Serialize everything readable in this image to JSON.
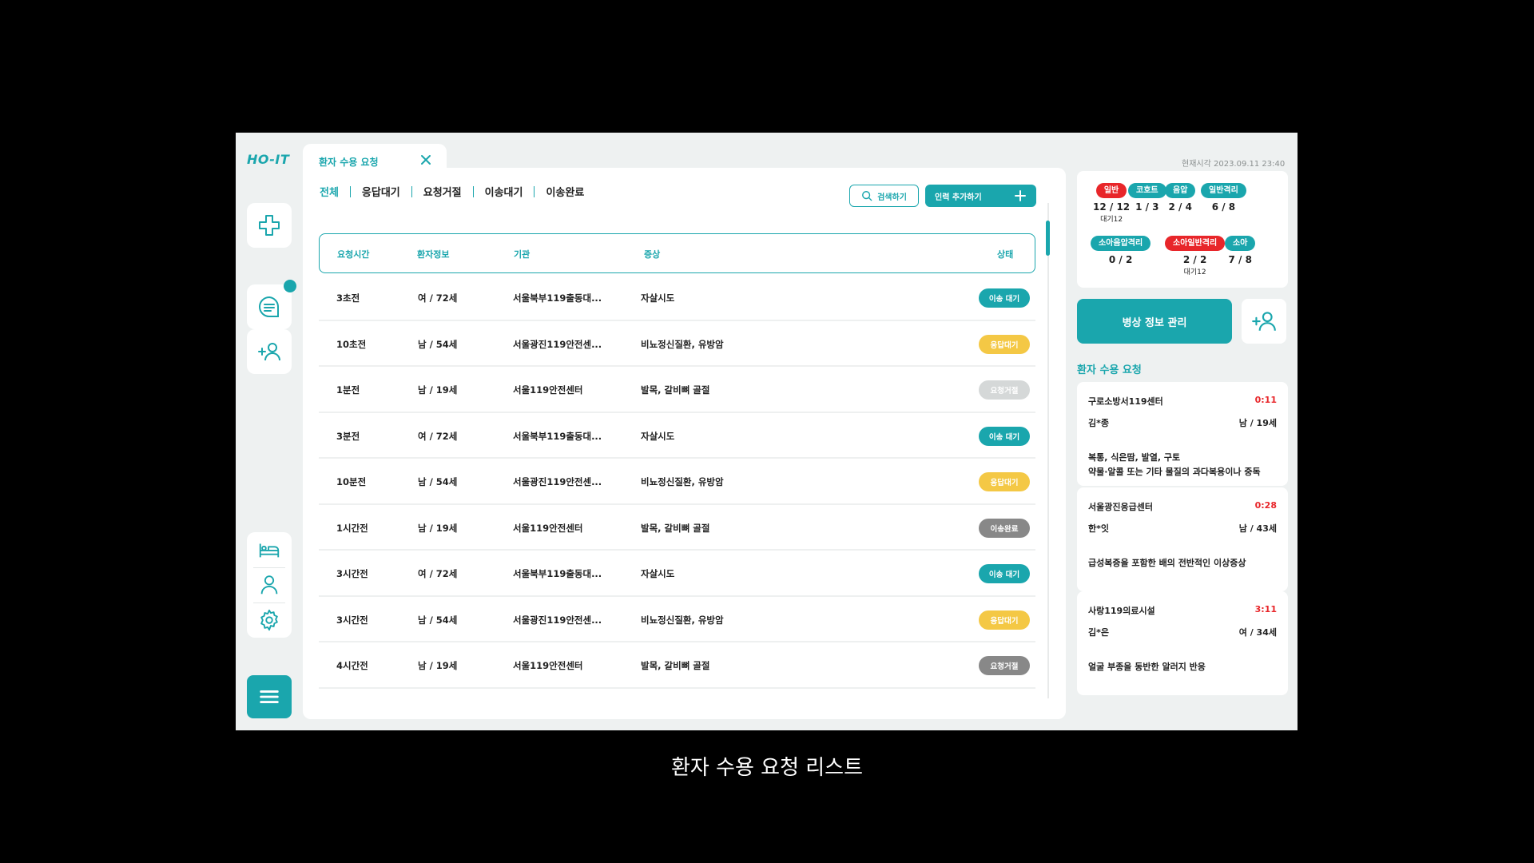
{
  "app": {
    "logo": "HO-IT"
  },
  "tab": {
    "label": "환자 수용 요청"
  },
  "filters": [
    "전체",
    "응답대기",
    "요청거절",
    "이송대기",
    "이송완료"
  ],
  "actions": {
    "search_label": "검색하기",
    "add_label": "인력 추가하기"
  },
  "table": {
    "headers": {
      "time": "요청시간",
      "patient": "환자정보",
      "org": "기관",
      "symptom": "증상",
      "status": "상태"
    },
    "rows": [
      {
        "time": "3초전",
        "patient": "여 / 72세",
        "org": "서울북부119출동대...",
        "symptom": "자살시도",
        "status": "이송 대기",
        "status_type": "transfer"
      },
      {
        "time": "10초전",
        "patient": "남 / 54세",
        "org": "서울광진119안전센...",
        "symptom": "비뇨정신질환, 유방암",
        "status": "응답대기",
        "status_type": "pending"
      },
      {
        "time": "1분전",
        "patient": "남 / 19세",
        "org": "서울119안전센터",
        "symptom": "발목, 갈비뼈 골절",
        "status": "요청거절",
        "status_type": "rejected-light"
      },
      {
        "time": "3분전",
        "patient": "여 / 72세",
        "org": "서울북부119출동대...",
        "symptom": "자살시도",
        "status": "이송 대기",
        "status_type": "transfer"
      },
      {
        "time": "10분전",
        "patient": "남 / 54세",
        "org": "서울광진119안전센...",
        "symptom": "비뇨정신질환, 유방암",
        "status": "응답대기",
        "status_type": "pending"
      },
      {
        "time": "1시간전",
        "patient": "남 / 19세",
        "org": "서울119안전센터",
        "symptom": "발목, 갈비뼈 골절",
        "status": "이송완료",
        "status_type": "done"
      },
      {
        "time": "3시간전",
        "patient": "여 / 72세",
        "org": "서울북부119출동대...",
        "symptom": "자살시도",
        "status": "이송 대기",
        "status_type": "transfer"
      },
      {
        "time": "3시간전",
        "patient": "남 / 54세",
        "org": "서울광진119안전센...",
        "symptom": "비뇨정신질환, 유방암",
        "status": "응답대기",
        "status_type": "pending"
      },
      {
        "time": "4시간전",
        "patient": "남 / 19세",
        "org": "서울119안전센터",
        "symptom": "발목, 갈비뼈 골절",
        "status": "요청거절",
        "status_type": "rejected"
      }
    ]
  },
  "clock": "현재시각 2023.09.11 23:40",
  "beds": [
    {
      "label": "일반",
      "count": "12 / 12",
      "wait": "대기12",
      "color": "red"
    },
    {
      "label": "코호트",
      "count": "1 / 3",
      "wait": "",
      "color": "teal"
    },
    {
      "label": "음압",
      "count": "2 / 4",
      "wait": "",
      "color": "teal"
    },
    {
      "label": "일반격리",
      "count": "6 / 8",
      "wait": "",
      "color": "teal"
    },
    {
      "label": "소아음압격리",
      "count": "0 / 2",
      "wait": "",
      "color": "teal"
    },
    {
      "label": "소아일반격리",
      "count": "2 / 2",
      "wait": "대기12",
      "color": "red"
    },
    {
      "label": "소아",
      "count": "7 / 8",
      "wait": "",
      "color": "teal"
    }
  ],
  "bed_mgmt_label": "병상 정보 관리",
  "requests_title": "환자 수용 요청",
  "requests": [
    {
      "org": "구로소방서119센터",
      "time": "0:11",
      "name": "김*종",
      "sexage": "남 / 19세",
      "symptom": "복통, 식은땀, 발열, 구토\n약물·알콜 또는 기타 물질의 과다복용이나 중독"
    },
    {
      "org": "서울광진응급센터",
      "time": "0:28",
      "name": "한*잇",
      "sexage": "남 / 43세",
      "symptom": "급성복증을 포함한 배의 전반적인 이상증상"
    },
    {
      "org": "사랑119의료시설",
      "time": "3:11",
      "name": "김*은",
      "sexage": "여 / 34세",
      "symptom": "얼굴 부종을 동반한 알러지 반응"
    }
  ],
  "caption": "환자 수용 요청 리스트",
  "colors": {
    "accent": "#1aa6ad",
    "alert": "#e8262a",
    "pending": "#f4c845",
    "grey": "#888888"
  }
}
